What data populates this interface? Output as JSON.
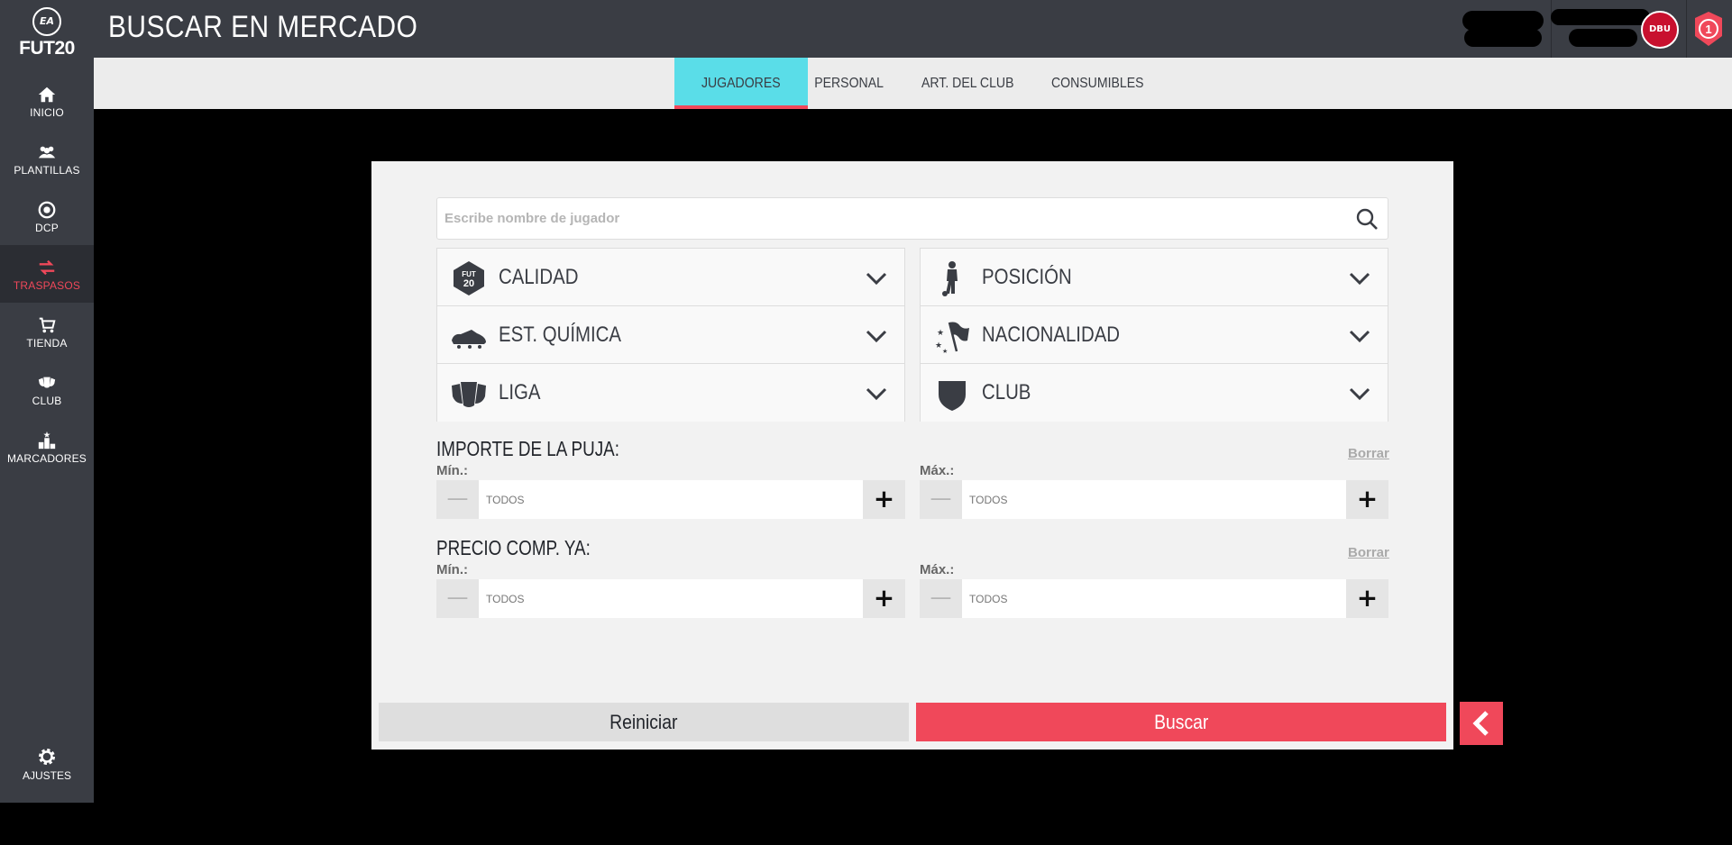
{
  "app": {
    "logo_top": "EA",
    "logo_text": "FUT20",
    "page_title": "BUSCAR EN MERCADO",
    "club_badge": "DBU",
    "level_badge": "1"
  },
  "sidebar": {
    "items": [
      {
        "label": "INICIO"
      },
      {
        "label": "PLANTILLAS"
      },
      {
        "label": "DCP"
      },
      {
        "label": "TRASPASOS"
      },
      {
        "label": "TIENDA"
      },
      {
        "label": "CLUB"
      },
      {
        "label": "MARCADORES"
      }
    ],
    "settings_label": "AJUSTES",
    "active_color": "#f0485a"
  },
  "tabs": [
    {
      "label": "JUGADORES"
    },
    {
      "label": "PERSONAL"
    },
    {
      "label": "ART. DEL CLUB"
    },
    {
      "label": "CONSUMIBLES"
    }
  ],
  "search": {
    "placeholder": "Escribe nombre de jugador",
    "value": ""
  },
  "filters": {
    "left": [
      {
        "label": "CALIDAD",
        "icon": "quality-icon"
      },
      {
        "label": "EST. QUÍMICA",
        "icon": "boot-icon"
      },
      {
        "label": "LIGA",
        "icon": "league-icon"
      }
    ],
    "right": [
      {
        "label": "POSICIÓN",
        "icon": "player-icon"
      },
      {
        "label": "NACIONALIDAD",
        "icon": "flag-icon"
      },
      {
        "label": "CLUB",
        "icon": "shield-icon"
      }
    ]
  },
  "bid_price": {
    "title": "IMPORTE DE LA PUJA:",
    "clear": "Borrar",
    "min_label": "Mín.:",
    "max_label": "Máx.:",
    "min_placeholder": "TODOS",
    "max_placeholder": "TODOS"
  },
  "buy_now": {
    "title": "PRECIO COMP. YA:",
    "clear": "Borrar",
    "min_label": "Mín.:",
    "max_label": "Máx.:",
    "min_placeholder": "TODOS",
    "max_placeholder": "TODOS"
  },
  "actions": {
    "reset": "Reiniciar",
    "search": "Buscar"
  },
  "colors": {
    "accent": "#f0485a",
    "tab_active": "#5adde8",
    "sidebar": "#3a3d44"
  }
}
